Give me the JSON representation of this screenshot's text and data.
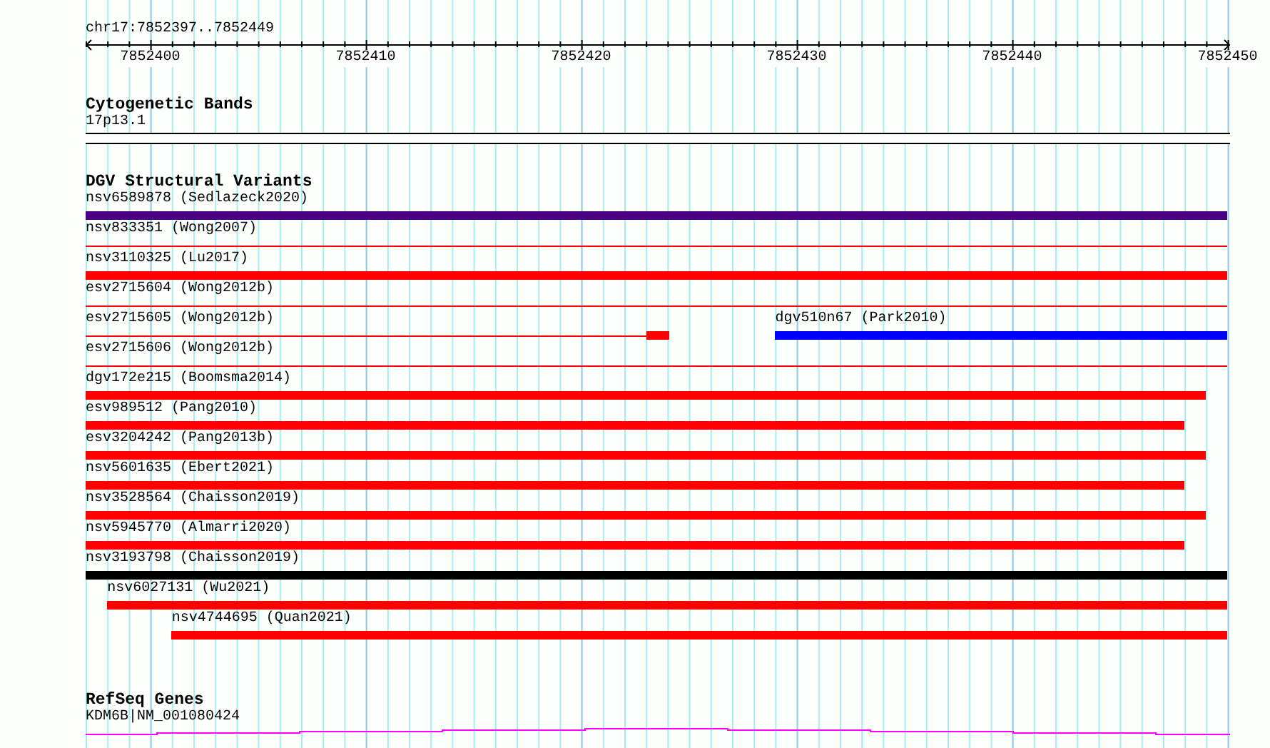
{
  "ruler": {
    "location": "chr17:7852397..7852449",
    "ticks": [
      "7852400",
      "7852410",
      "7852420",
      "7852430",
      "7852440",
      "7852450"
    ]
  },
  "cytogenetic_bands": {
    "title": "Cytogenetic Bands",
    "bands": [
      {
        "label": "17p13.1"
      }
    ]
  },
  "dgv": {
    "title": "DGV Structural Variants",
    "rows": [
      {
        "features": [
          {
            "label": "nsv6589878 (Sedlazeck2020)",
            "color": "#4b0082",
            "segments": [
              {
                "kind": "thick"
              }
            ]
          }
        ]
      },
      {
        "features": [
          {
            "label": "nsv833351 (Wong2007)",
            "color": "#ff0000",
            "segments": [
              {
                "kind": "thin"
              }
            ]
          }
        ]
      },
      {
        "features": [
          {
            "label": "nsv3110325 (Lu2017)",
            "color": "#ff0000",
            "segments": [
              {
                "kind": "thick"
              }
            ]
          }
        ]
      },
      {
        "features": [
          {
            "label": "esv2715604 (Wong2012b)",
            "color": "#ff0000",
            "segments": [
              {
                "kind": "thin"
              }
            ]
          }
        ]
      },
      {
        "features": [
          {
            "label": "esv2715605 (Wong2012b)",
            "color": "#ff0000",
            "segments": [
              {
                "kind": "thin"
              },
              {
                "kind": "thick"
              }
            ]
          },
          {
            "label": "dgv510n67 (Park2010)",
            "color": "#0000ff",
            "segments": [
              {
                "kind": "thick"
              }
            ]
          }
        ]
      },
      {
        "features": [
          {
            "label": "esv2715606 (Wong2012b)",
            "color": "#ff0000",
            "segments": [
              {
                "kind": "thin"
              }
            ]
          }
        ]
      },
      {
        "features": [
          {
            "label": "dgv172e215 (Boomsma2014)",
            "color": "#ff0000",
            "segments": [
              {
                "kind": "thick"
              }
            ]
          }
        ]
      },
      {
        "features": [
          {
            "label": "esv989512 (Pang2010)",
            "color": "#ff0000",
            "segments": [
              {
                "kind": "thick"
              }
            ]
          }
        ]
      },
      {
        "features": [
          {
            "label": "esv3204242 (Pang2013b)",
            "color": "#ff0000",
            "segments": [
              {
                "kind": "thick"
              }
            ]
          }
        ]
      },
      {
        "features": [
          {
            "label": "nsv5601635 (Ebert2021)",
            "color": "#ff0000",
            "segments": [
              {
                "kind": "thick"
              }
            ]
          }
        ]
      },
      {
        "features": [
          {
            "label": "nsv3528564 (Chaisson2019)",
            "color": "#ff0000",
            "segments": [
              {
                "kind": "thick"
              }
            ]
          }
        ]
      },
      {
        "features": [
          {
            "label": "nsv5945770 (Almarri2020)",
            "color": "#ff0000",
            "segments": [
              {
                "kind": "thick"
              }
            ]
          }
        ]
      },
      {
        "features": [
          {
            "label": "nsv3193798 (Chaisson2019)",
            "color": "#000000",
            "segments": [
              {
                "kind": "thick"
              }
            ]
          }
        ]
      },
      {
        "features": [
          {
            "label": "nsv6027131 (Wu2021)",
            "color": "#ff0000",
            "segments": [
              {
                "kind": "thick"
              }
            ]
          }
        ]
      },
      {
        "features": [
          {
            "label": "nsv4744695 (Quan2021)",
            "color": "#ff0000",
            "segments": [
              {
                "kind": "thick"
              }
            ]
          }
        ]
      }
    ]
  },
  "refseq": {
    "title": "RefSeq Genes",
    "genes": [
      {
        "label": "KDM6B|NM_001080424"
      }
    ]
  }
}
